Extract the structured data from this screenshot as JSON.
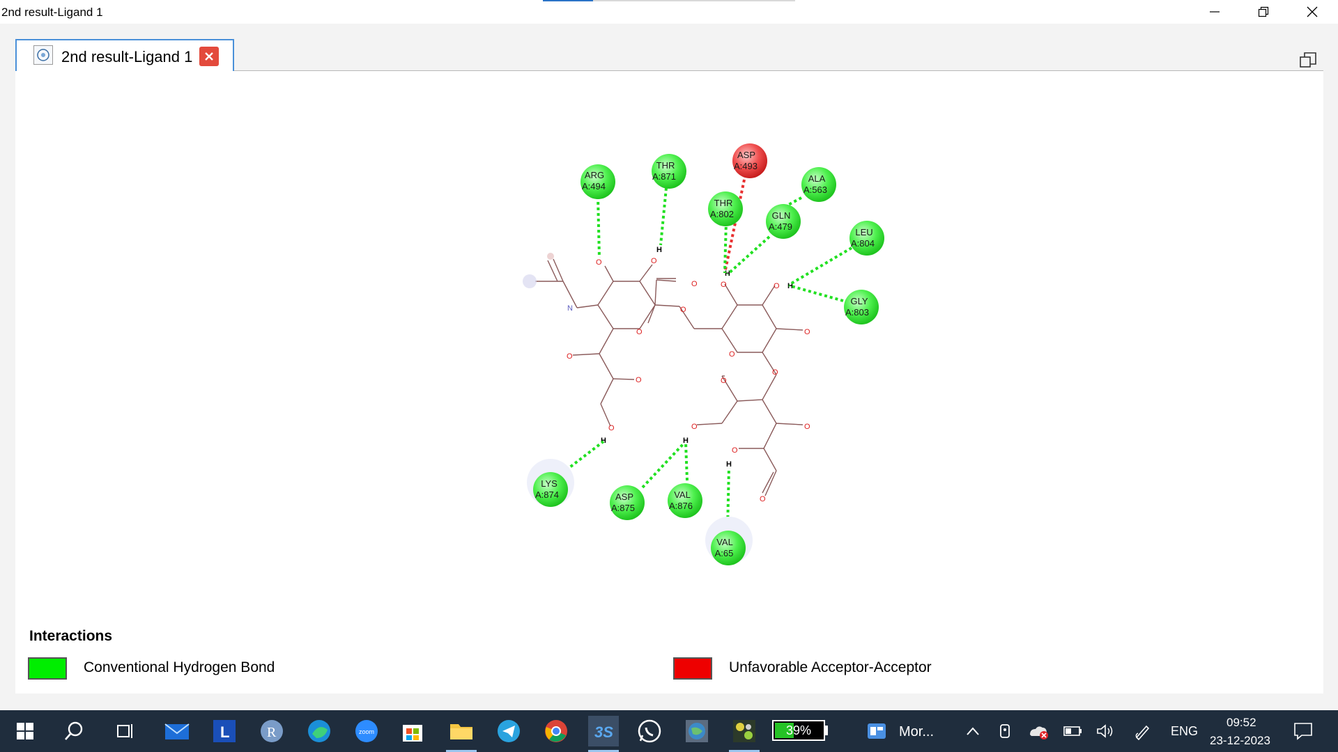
{
  "window": {
    "title": "2nd result-Ligand 1",
    "tab_label": "2nd result-Ligand 1"
  },
  "diagram": {
    "residues": [
      {
        "name": "ARG",
        "id": "A:494",
        "type": "conventional"
      },
      {
        "name": "THR",
        "id": "A:871",
        "type": "conventional"
      },
      {
        "name": "ASP",
        "id": "A:493",
        "type": "unfavorable"
      },
      {
        "name": "ALA",
        "id": "A:563",
        "type": "conventional"
      },
      {
        "name": "THR",
        "id": "A:802",
        "type": "conventional"
      },
      {
        "name": "GLN",
        "id": "A:479",
        "type": "conventional"
      },
      {
        "name": "LEU",
        "id": "A:804",
        "type": "conventional"
      },
      {
        "name": "GLY",
        "id": "A:803",
        "type": "conventional"
      },
      {
        "name": "LYS",
        "id": "A:874",
        "type": "conventional"
      },
      {
        "name": "ASP",
        "id": "A:875",
        "type": "conventional"
      },
      {
        "name": "VAL",
        "id": "A:876",
        "type": "conventional"
      },
      {
        "name": "VAL",
        "id": "A:65",
        "type": "conventional"
      }
    ],
    "atom_labels": {
      "oxygen": "O",
      "nitrogen": "N",
      "hydrogen": "H"
    }
  },
  "legend": {
    "title": "Interactions",
    "items": [
      {
        "label": "Conventional Hydrogen Bond",
        "color": "#00ee00"
      },
      {
        "label": "Unfavorable Acceptor-Acceptor",
        "color": "#ee0000"
      }
    ]
  },
  "taskbar": {
    "battery": "39%",
    "widget_label": "Mor...",
    "language": "ENG",
    "time": "09:52",
    "date": "23-12-2023",
    "apps": [
      "start-icon",
      "search-icon",
      "task-view-icon",
      "mail-icon",
      "l-app-icon",
      "r-app-icon",
      "edge-icon",
      "zoom-icon",
      "store-icon",
      "file-explorer-icon",
      "telegram-icon",
      "chrome-icon",
      "discovery-studio-icon",
      "whatsapp-icon",
      "globe-app-icon",
      "molecule-app-icon"
    ]
  },
  "colors": {
    "conventional": "#22e022",
    "unfavorable": "#e83030",
    "taskbar": "#1f2d3d"
  }
}
